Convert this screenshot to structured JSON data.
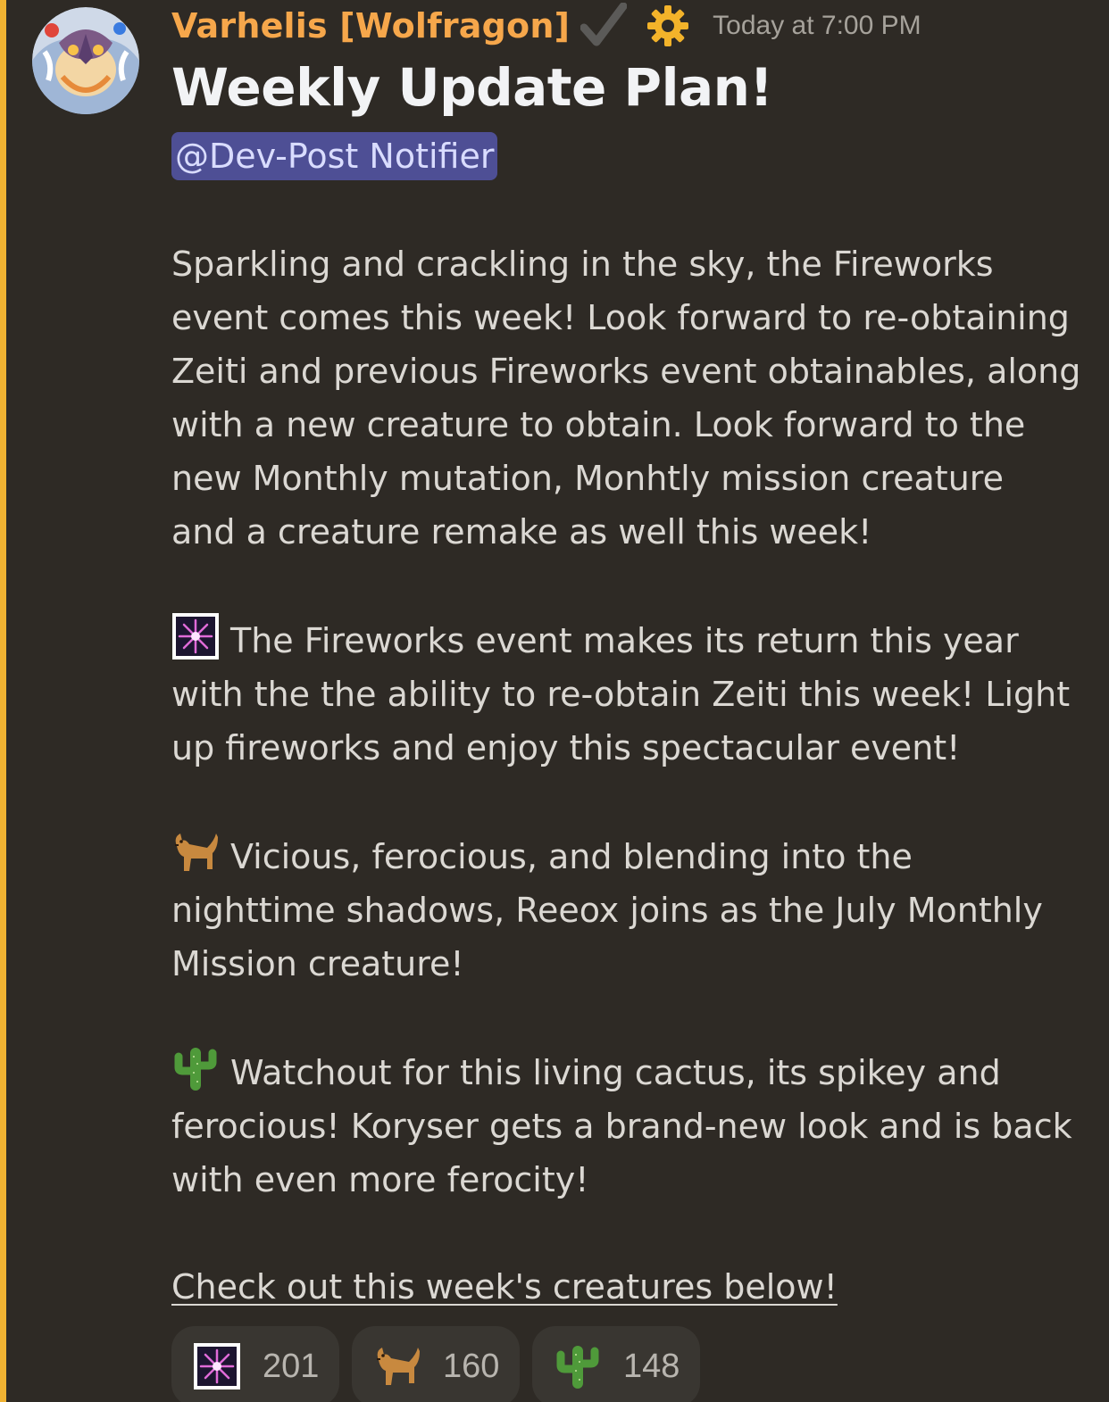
{
  "message": {
    "author": "Varhelis [Wolfragon]",
    "timestamp": "Today at 7:00 PM",
    "title": "Weekly Update Plan!",
    "mention": "@Dev-Post Notifier",
    "intro_lines": [
      "Sparkling and crackling in the sky, the Fireworks",
      "event comes this week! Look forward to re-obtaining",
      "Zeiti and previous Fireworks event obtainables, along",
      "with a new creature to obtain. Look forward to the",
      "new Monthly mutation, Monhtly mission creature",
      "and a creature remake as well this week!"
    ],
    "sections": [
      {
        "icon": "fireworks-icon",
        "lines": [
          "The Fireworks event makes its return this year",
          "with the the ability to re-obtain Zeiti this week! Light",
          "up fireworks and enjoy this spectacular event!"
        ]
      },
      {
        "icon": "dog-icon",
        "lines": [
          "Vicious, ferocious, and blending into the",
          "nighttime shadows, Reeox joins as the July Monthly",
          "Mission creature!"
        ]
      },
      {
        "icon": "cactus-icon",
        "lines": [
          "Watchout for this living cactus, its spikey and",
          "ferocious! Koryser gets a brand-new look and is back",
          "with even more ferocity!"
        ]
      }
    ],
    "link_text": "Check out this week's creatures below!"
  },
  "reactions": [
    {
      "icon": "fireworks-icon",
      "count": "201"
    },
    {
      "icon": "dog-icon",
      "count": "160"
    },
    {
      "icon": "cactus-icon",
      "count": "148"
    }
  ],
  "colors": {
    "background": "#2e2a25",
    "highlight_bar": "#f0b232",
    "username": "#f6a74b",
    "mention_bg": "#4e4f95",
    "reaction_bg": "#393631"
  }
}
